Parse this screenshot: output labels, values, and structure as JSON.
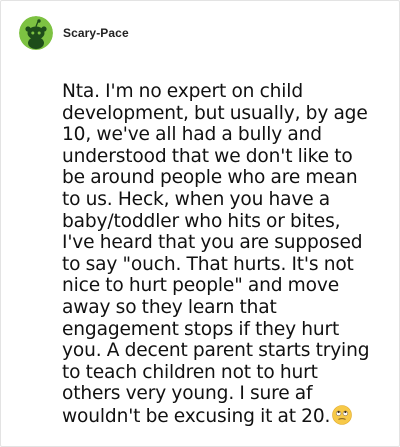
{
  "post": {
    "username": "Scary-Pace",
    "avatar_icon": "reddit-snoo-avatar-icon",
    "avatar_color": "#7dc242",
    "lines": [
      "Nta. I'm no expert on child",
      "development, but usually, by age",
      "10, we've all had a bully and",
      "understood that we don't like to",
      "be around people who are mean",
      "to us. Heck, when you have a",
      "baby/toddler who hits or bites,",
      "I've heard that you are supposed",
      "to say \"ouch. That hurts. It's not",
      "nice to hurt people\" and move",
      "away so they learn that",
      "engagement stops if they hurt",
      "you. A decent parent starts trying",
      "to teach children not to hurt",
      "others very young. I sure af",
      "wouldn't be excusing it at 20."
    ],
    "trailing_emoji": "eye-roll-emoji-icon"
  }
}
